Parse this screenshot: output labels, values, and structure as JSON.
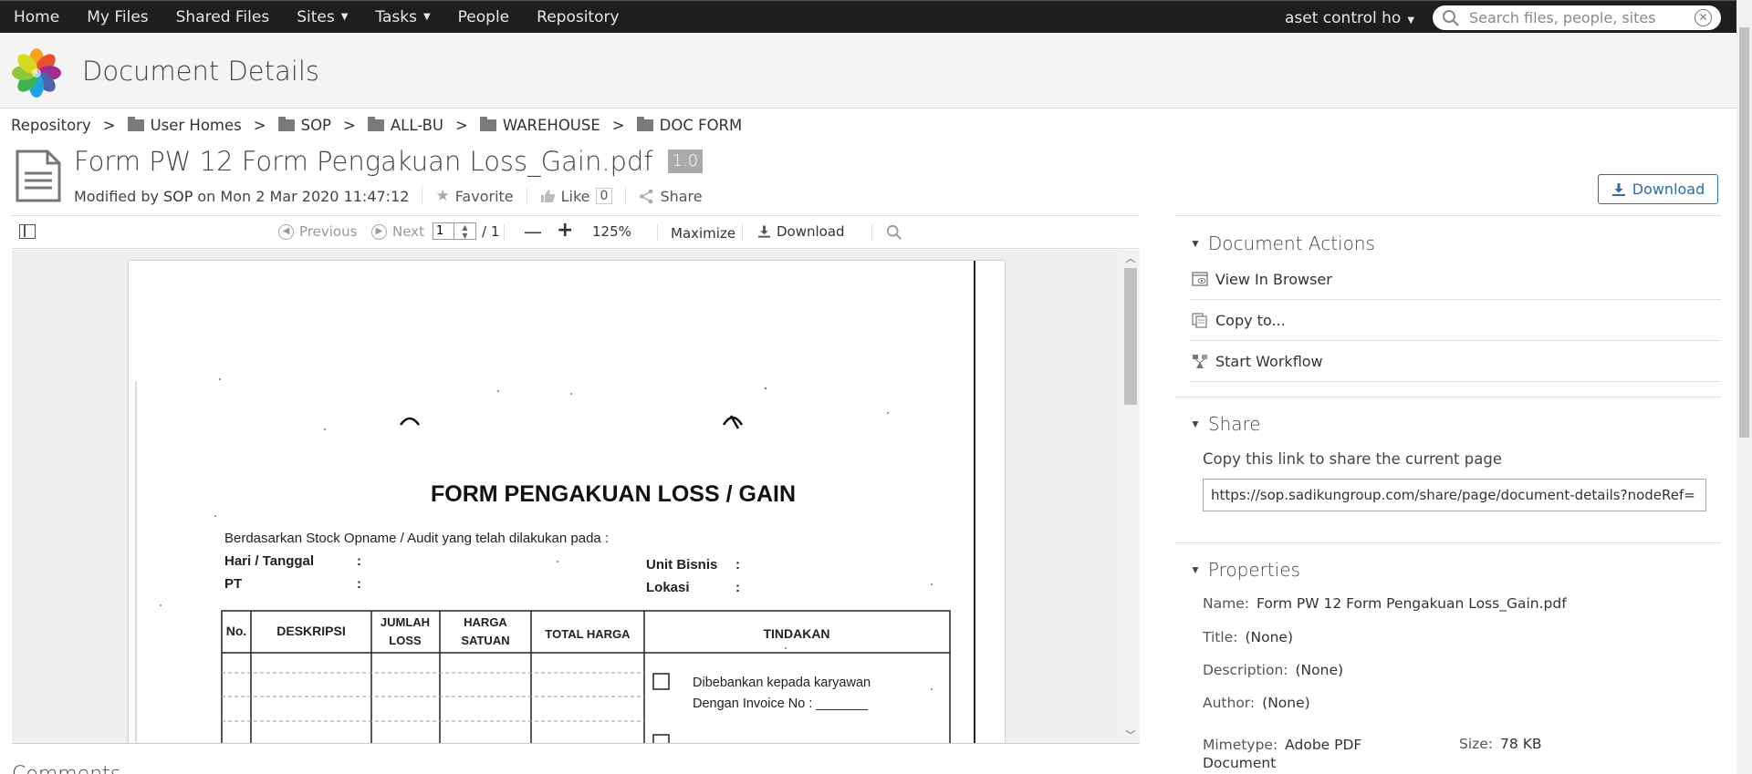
{
  "nav": {
    "items": [
      {
        "label": "Home",
        "has_menu": false
      },
      {
        "label": "My Files",
        "has_menu": false
      },
      {
        "label": "Shared Files",
        "has_menu": false
      },
      {
        "label": "Sites",
        "has_menu": true
      },
      {
        "label": "Tasks",
        "has_menu": true
      },
      {
        "label": "People",
        "has_menu": false
      },
      {
        "label": "Repository",
        "has_menu": false
      }
    ],
    "user": "aset control ho",
    "search_placeholder": "Search files, people, sites"
  },
  "header": {
    "title": "Document Details"
  },
  "breadcrumb": [
    "Repository",
    "User Homes",
    "SOP",
    "ALL-BU",
    "WAREHOUSE",
    "DOC FORM"
  ],
  "document": {
    "title": "Form PW 12 Form Pengakuan Loss_Gain.pdf",
    "version": "1.0",
    "modified_prefix": "Modified by",
    "modified_by": "SOP",
    "modified_on": "on Mon 2 Mar 2020 11:47:12",
    "favorite_label": "Favorite",
    "like_label": "Like",
    "like_count": "0",
    "share_label": "Share",
    "download_label": "Download"
  },
  "viewer": {
    "previous_label": "Previous",
    "next_label": "Next",
    "page_number": "1",
    "page_total": "/ 1",
    "zoom": "125%",
    "maximize_label": "Maximize",
    "download_label": "Download"
  },
  "pdf": {
    "form_title": "FORM PENGAKUAN LOSS / GAIN",
    "intro": "Berdasarkan Stock Opname / Audit yang telah dilakukan pada :",
    "field_date": "Hari / Tanggal",
    "field_pt": "PT",
    "field_unit": "Unit Bisnis",
    "field_location": "Lokasi",
    "colon": ":",
    "columns": {
      "no": "No.",
      "desc": "DESKRIPSI",
      "qty_1": "JUMLAH",
      "qty_2": "LOSS",
      "price_1": "HARGA",
      "price_2": "SATUAN",
      "total": "TOTAL HARGA",
      "action": "TINDAKAN"
    },
    "option_1_line1": "Dibebankan kepada karyawan",
    "option_1_line2": "Dengan Invoice No : _______"
  },
  "comments_heading": "Comments",
  "panel": {
    "document_actions": {
      "title": "Document Actions",
      "items": [
        "View In Browser",
        "Copy to...",
        "Start Workflow"
      ]
    },
    "share": {
      "title": "Share",
      "label": "Copy this link to share the current page",
      "url": "https://sop.sadikungroup.com/share/page/document-details?nodeRef="
    },
    "properties": {
      "title": "Properties",
      "name_key": "Name:",
      "name_value": "Form PW 12 Form Pengakuan Loss_Gain.pdf",
      "title_key": "Title:",
      "title_value": "(None)",
      "description_key": "Description:",
      "description_value": "(None)",
      "author_key": "Author:",
      "author_value": "(None)",
      "mimetype_key": "Mimetype:",
      "mimetype_value_1": "Adobe PDF",
      "mimetype_value_2": "Document",
      "size_key": "Size:",
      "size_value": "78 KB"
    }
  },
  "colors": {
    "nav_bg": "#1e1e1e",
    "accent": "#2e6ba7",
    "header_bg": "#f4f4f4"
  }
}
